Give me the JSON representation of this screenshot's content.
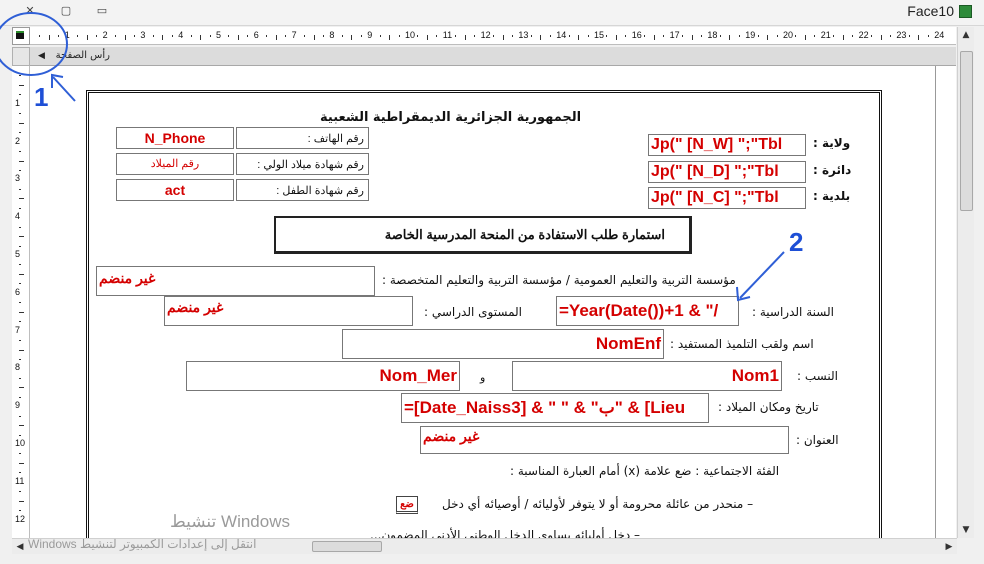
{
  "window": {
    "title": "Face10",
    "section_header": "رأس الصفحة",
    "vertical_ruler": [
      "1",
      "2",
      "3",
      "4",
      "5",
      "6",
      "7",
      "8",
      "9",
      "10",
      "11",
      "12"
    ],
    "horizontal_ruler": [
      "1",
      "2",
      "3",
      "4",
      "5",
      "6",
      "7",
      "8",
      "9",
      "10",
      "11",
      "12",
      "13",
      "14",
      "15",
      "16",
      "17",
      "18",
      "19",
      "20",
      "21",
      "22",
      "23",
      "24"
    ]
  },
  "form": {
    "republic_title": "الجمهورية الجزائرية الديمقراطية الشعبية",
    "left_fields": [
      {
        "label": "رقم الهاتف :",
        "value": "N_Phone"
      },
      {
        "label": "رقم شهادة ميلاد الولي :",
        "value": "رقم الميلاد"
      },
      {
        "label": "رقم شهادة الطفل :",
        "value": "act"
      }
    ],
    "right_fields": [
      {
        "label": "ولاية :",
        "value": "Jp(\" [N_W] \";\"Tbl"
      },
      {
        "label": "دائرة :",
        "value": "Jp(\" [N_D] \";\"Tbl"
      },
      {
        "label": "بلدية :",
        "value": "Jp(\" [N_C] \";\"Tbl"
      }
    ],
    "form_title": "استمارة طلب الاستفادة من المنحة المدرسية الخاصة",
    "rows": {
      "institution_label": "مؤسسة التربية والتعليم العمومية / مؤسسة التربية والتعليم المتخصصة :",
      "institution_value": "غير منضم",
      "year_label": "السنة الدراسية :",
      "year_value": "=Year(Date())+1 & \"/",
      "level_label": "المستوى الدراسي :",
      "level_value": "غير منضم",
      "student_label": "اسم ولقب التلميذ المستفيد :",
      "student_value": "NomEnf",
      "lineage_label": "النسب :",
      "lineage_value1": "Nom1",
      "lineage_and": "و",
      "lineage_value2": "Nom_Mer",
      "birth_label": "تاريخ ومكان الميلاد :",
      "birth_value": "=[Date_Naiss3] & \" \" & \"ب\" & [Lieu",
      "address_label": "العنوان :",
      "address_value": "غير منضم",
      "social_label": "الفئة الاجتماعية : ضع علامة (x) أمام العبارة المناسبة :",
      "option1_text": "– منحدر من عائلة محرومة أو لا يتوفر لأوليائه / أوصيائه أي دخل",
      "option1_check": "ضع",
      "option2_text": "– دخل أوليائه يساوي الدخل الوطني الأدنى المضمون..."
    }
  },
  "annotations": {
    "first": "1",
    "second": "2"
  },
  "overlay": {
    "activation_title": "تنشيط Windows",
    "activation_text": "انتقل إلى إعدادات الكمبيوتر لتنشيط Windows"
  }
}
